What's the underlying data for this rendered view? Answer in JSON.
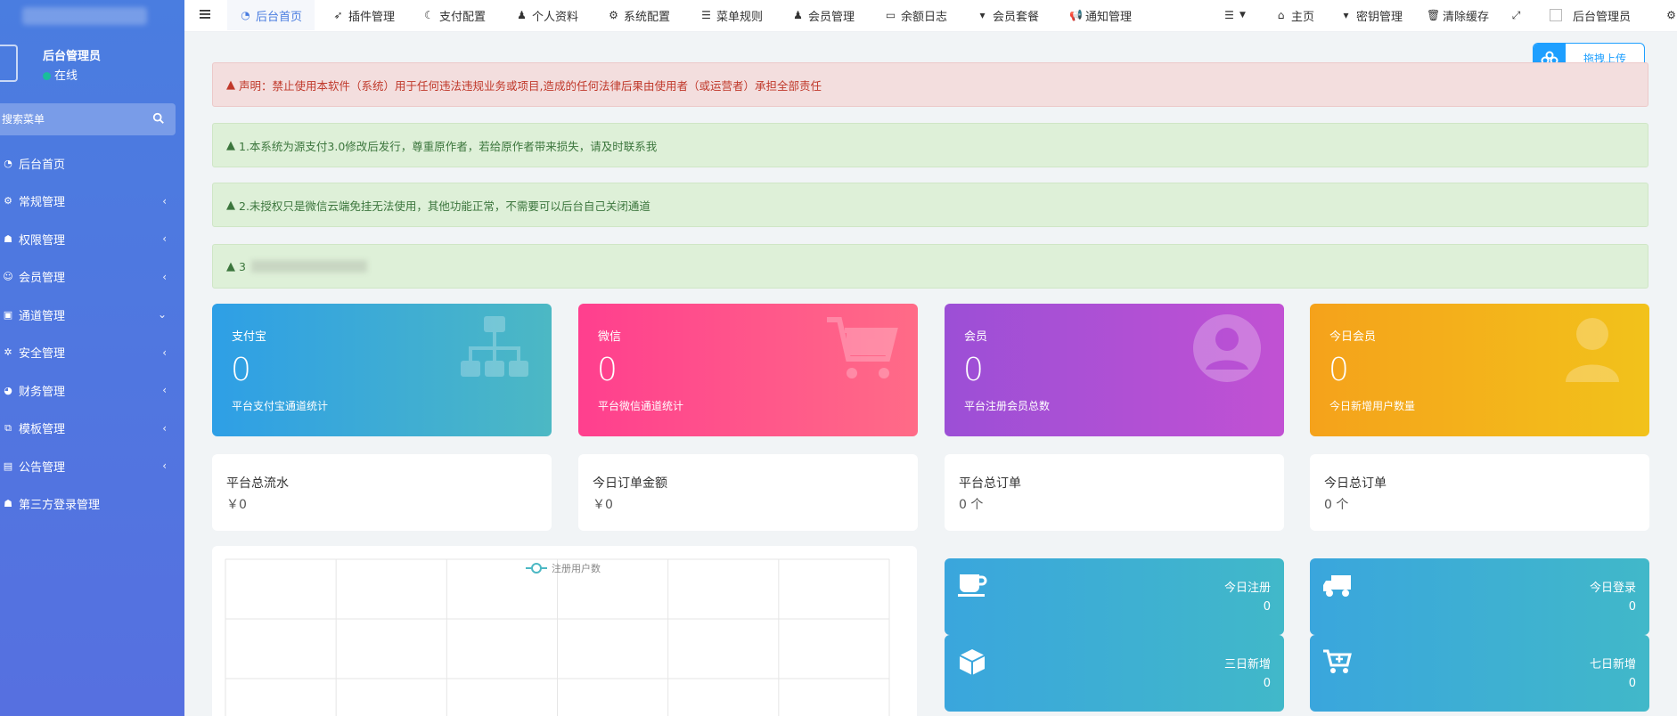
{
  "sidebar": {
    "user": {
      "name": "后台管理员",
      "status": "在线"
    },
    "search_placeholder": "搜索菜单",
    "items": [
      {
        "label": "后台首页"
      },
      {
        "label": "常规管理"
      },
      {
        "label": "权限管理"
      },
      {
        "label": "会员管理"
      },
      {
        "label": "通道管理"
      },
      {
        "label": "安全管理"
      },
      {
        "label": "财务管理"
      },
      {
        "label": "模板管理"
      },
      {
        "label": "公告管理"
      },
      {
        "label": "第三方登录管理"
      }
    ]
  },
  "topbar": {
    "tabs": [
      {
        "label": "后台首页"
      },
      {
        "label": "插件管理"
      },
      {
        "label": "支付配置"
      },
      {
        "label": "个人资料"
      },
      {
        "label": "系统配置"
      },
      {
        "label": "菜单规则"
      },
      {
        "label": "会员管理"
      },
      {
        "label": "余额日志"
      },
      {
        "label": "会员套餐"
      },
      {
        "label": "通知管理"
      }
    ],
    "right": {
      "home": "主页",
      "keys": "密钥管理",
      "clear_cache": "清除缓存",
      "user": "后台管理员"
    }
  },
  "upload_button": "拖拽上传",
  "alerts": [
    {
      "type": "danger",
      "text": "声明：禁止使用本软件（系统）用于任何违法违规业务或项目,造成的任何法律后果由使用者（或运营者）承担全部责任"
    },
    {
      "type": "success",
      "text": "1.本系统为源支付3.0修改后发行，尊重原作者，若给原作者带来损失，请及时联系我"
    },
    {
      "type": "success",
      "text": "2.未授权只是微信云端免挂无法使用，其他功能正常，不需要可以后台自己关闭通道"
    },
    {
      "type": "success",
      "text": "3"
    }
  ],
  "stat_cards": [
    {
      "title": "支付宝",
      "value": "0",
      "sub": "平台支付宝通道统计",
      "icon": "sitemap-icon",
      "color_from": "#2e9fe6",
      "color_to": "#4cb8c4"
    },
    {
      "title": "微信",
      "value": "0",
      "sub": "平台微信通道统计",
      "icon": "cart-icon",
      "color_from": "#ff3f8e",
      "color_to": "#ff6b87"
    },
    {
      "title": "会员",
      "value": "0",
      "sub": "平台注册会员总数",
      "icon": "user-circle-icon",
      "color_from": "#9c4fd6",
      "color_to": "#c151d3"
    },
    {
      "title": "今日会员",
      "value": "0",
      "sub": "今日新增用户数量",
      "icon": "user-icon",
      "color_from": "#f5a21b",
      "color_to": "#f2c21b"
    }
  ],
  "info_cards": [
    {
      "title": "平台总流水",
      "value": "￥0"
    },
    {
      "title": "今日订单金额",
      "value": "￥0"
    },
    {
      "title": "平台总订单",
      "value": "0 个"
    },
    {
      "title": "今日总订单",
      "value": "0 个"
    }
  ],
  "chart_data": {
    "type": "line",
    "legend": [
      "注册用户数"
    ],
    "series": [
      {
        "name": "注册用户数",
        "values": []
      }
    ]
  },
  "mini_cards": [
    {
      "title": "今日注册",
      "value": "0",
      "icon": "coffee-icon"
    },
    {
      "title": "今日登录",
      "value": "0",
      "icon": "truck-icon"
    },
    {
      "title": "三日新增",
      "value": "0",
      "icon": "cube-icon"
    },
    {
      "title": "七日新增",
      "value": "0",
      "icon": "cart-plus-icon"
    }
  ]
}
